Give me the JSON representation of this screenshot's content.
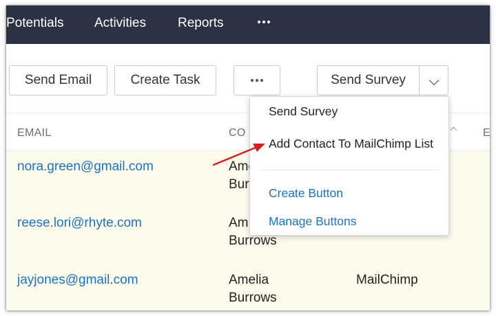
{
  "topnav": {
    "items": [
      "Potentials",
      "Activities",
      "Reports"
    ]
  },
  "toolbar": {
    "send_email": "Send Email",
    "create_task": "Create Task",
    "send_survey": "Send Survey"
  },
  "table": {
    "columns": [
      "EMAIL",
      "CO",
      "E"
    ],
    "rows": [
      {
        "email": "nora.green@gmail.com",
        "contact_line1": "Ame",
        "contact_line2": "Burr",
        "extra": ""
      },
      {
        "email": "reese.lori@rhyte.com",
        "contact_line1": "Am",
        "contact_line2": "Burrows",
        "extra": ""
      },
      {
        "email": "jayjones@gmail.com",
        "contact_line1": "Amelia",
        "contact_line2": "Burrows",
        "extra": "MailChimp"
      }
    ]
  },
  "dropdown": {
    "items": [
      "Send Survey",
      "Add Contact To MailChimp List"
    ],
    "links": [
      "Create Button",
      "Manage Buttons"
    ]
  },
  "colors": {
    "nav_bg": "#2a3243",
    "link": "#1a73c6",
    "row_bg": "#fdfbec",
    "annotation_arrow": "#d42020"
  }
}
